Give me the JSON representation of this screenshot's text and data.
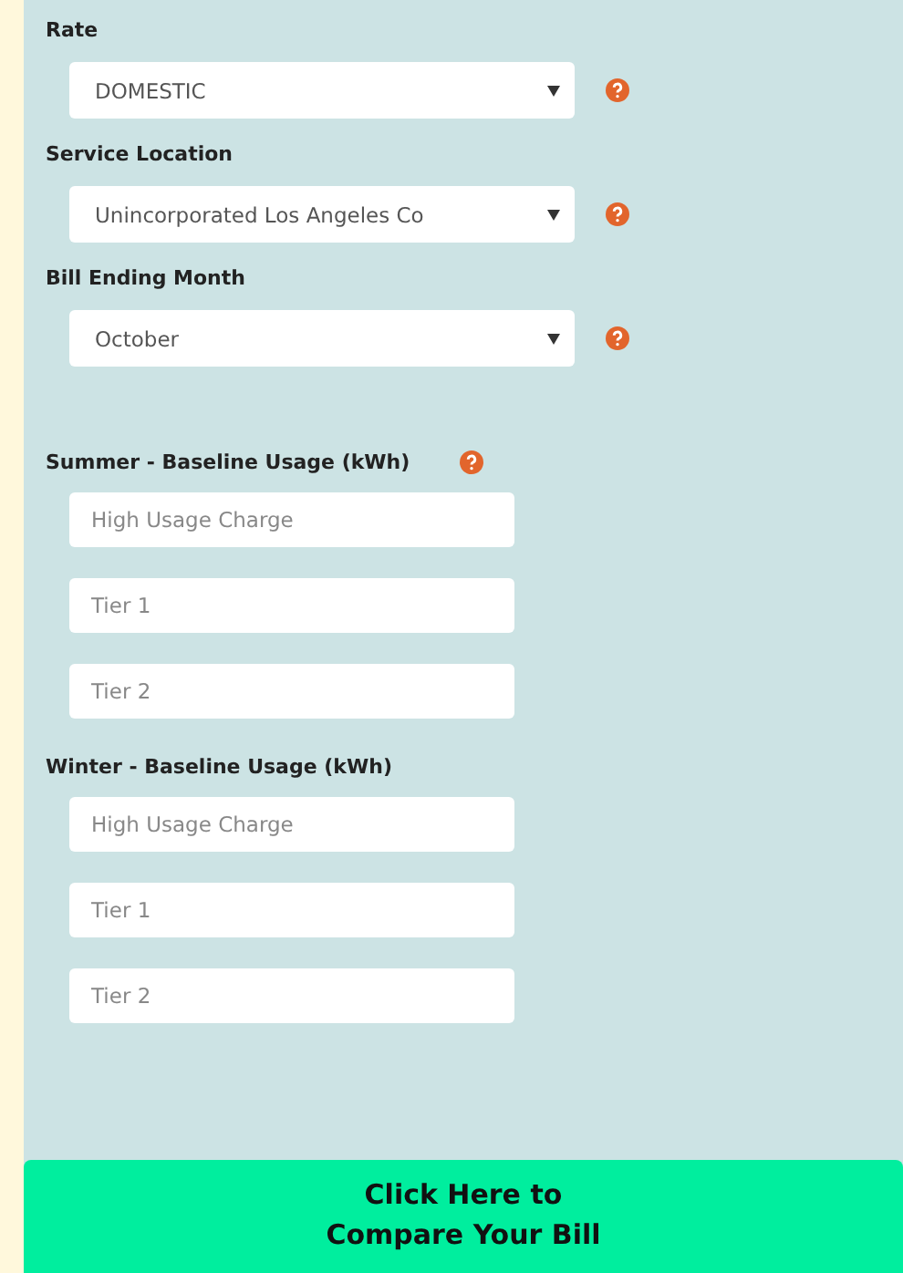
{
  "selects": [
    {
      "label": "Rate",
      "value": "DOMESTIC",
      "help": true
    },
    {
      "label": "Service Location",
      "value": "Unincorporated Los Angeles Co",
      "help": true
    },
    {
      "label": "Bill Ending Month",
      "value": "October",
      "help": true
    }
  ],
  "usage_groups": [
    {
      "label": "Summer - Baseline Usage (kWh)",
      "help": true,
      "fields": [
        {
          "placeholder": "High Usage Charge"
        },
        {
          "placeholder": "Tier 1"
        },
        {
          "placeholder": "Tier 2"
        }
      ]
    },
    {
      "label": "Winter - Baseline Usage (kWh)",
      "help": false,
      "fields": [
        {
          "placeholder": "High Usage Charge"
        },
        {
          "placeholder": "Tier 1"
        },
        {
          "placeholder": "Tier 2"
        }
      ]
    }
  ],
  "submit_button": {
    "lines": [
      "Click Here to",
      "Compare Your Bill"
    ]
  }
}
